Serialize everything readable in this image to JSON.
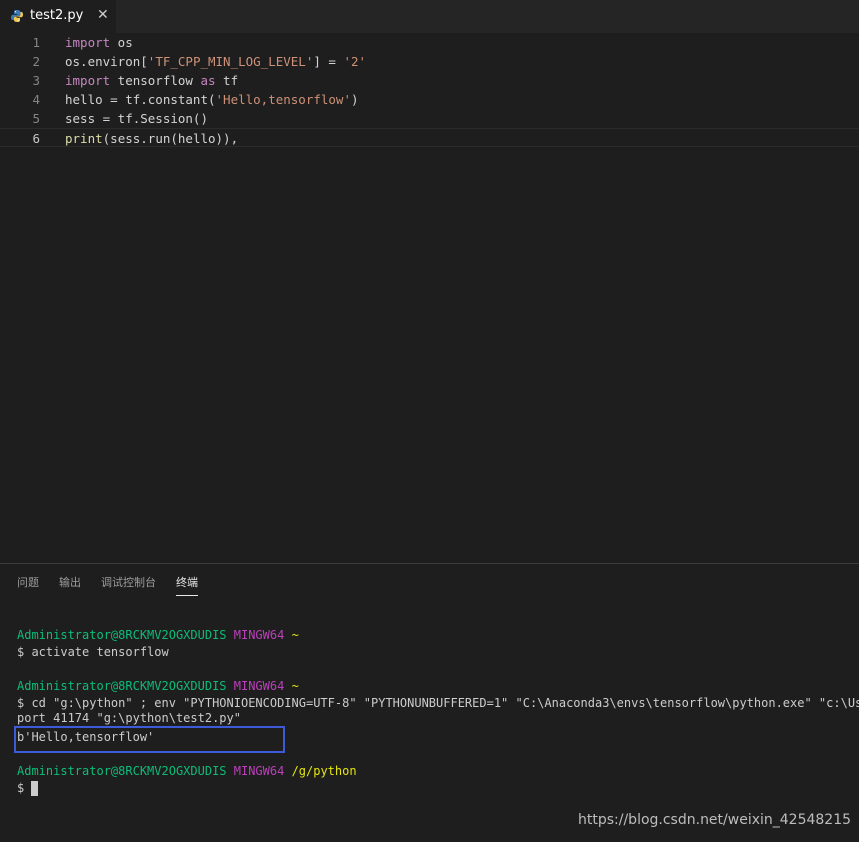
{
  "tab": {
    "filename": "test2.py",
    "close": "✕"
  },
  "code": [
    {
      "n": "1",
      "parts": [
        {
          "t": "import",
          "c": "kw"
        },
        {
          "t": " os",
          "c": ""
        }
      ]
    },
    {
      "n": "2",
      "parts": [
        {
          "t": "os.environ[",
          "c": ""
        },
        {
          "t": "'TF_CPP_MIN_LOG_LEVEL'",
          "c": "str"
        },
        {
          "t": "] = ",
          "c": ""
        },
        {
          "t": "'2'",
          "c": "str"
        }
      ]
    },
    {
      "n": "3",
      "parts": [
        {
          "t": "import",
          "c": "kw"
        },
        {
          "t": " tensorflow ",
          "c": ""
        },
        {
          "t": "as",
          "c": "kw"
        },
        {
          "t": " tf",
          "c": ""
        }
      ]
    },
    {
      "n": "4",
      "parts": [
        {
          "t": "hello = tf.constant(",
          "c": ""
        },
        {
          "t": "'Hello,tensorflow'",
          "c": "str"
        },
        {
          "t": ")",
          "c": ""
        }
      ]
    },
    {
      "n": "5",
      "parts": [
        {
          "t": "sess = tf.Session()",
          "c": ""
        }
      ]
    },
    {
      "n": "6",
      "parts": [
        {
          "t": "print",
          "c": "fn"
        },
        {
          "t": "(sess.run(hello)),",
          "c": ""
        }
      ]
    }
  ],
  "panel": {
    "tabs": [
      "问题",
      "输出",
      "调试控制台",
      "终端"
    ],
    "active_tab": "终端"
  },
  "terminal": {
    "user_host": "Administrator@8RCKMV2OGXDUDIS",
    "shell": "MINGW64",
    "home": "~",
    "cmd1": "$ activate tensorflow",
    "cmd2": "$ cd \"g:\\python\" ; env \"PYTHONIOENCODING=UTF-8\" \"PYTHONUNBUFFERED=1\" \"C:\\Anaconda3\\envs\\tensorflow\\python.exe\" \"c:\\Users\\",
    "cmd2_wrap": "port 41174 \"g:\\python\\test2.py\"",
    "output": "b'Hello,tensorflow'",
    "cwd": "/g/python",
    "prompt": "$"
  },
  "colors": {
    "highlight_box": "#3d5bd9",
    "keyword": "#c586c0",
    "string": "#ce9178",
    "term_green": "#0dbc79",
    "term_magenta": "#bc3fbc",
    "term_yellow": "#e5e510"
  },
  "watermark": "https://blog.csdn.net/weixin_42548215"
}
